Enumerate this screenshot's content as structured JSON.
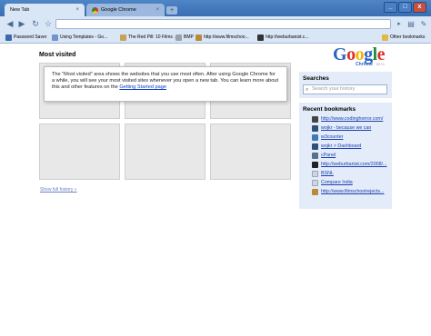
{
  "tabs": [
    {
      "label": "New Tab",
      "active": true
    },
    {
      "label": "Google Chrome",
      "active": false
    }
  ],
  "new_tab_button": "+",
  "window_controls": {
    "minimize": "_",
    "maximize": "□",
    "close": "x"
  },
  "omnibox": {
    "value": ""
  },
  "bookmarks_bar": {
    "items": [
      {
        "label": "Password Saver",
        "icon": "bookmark-icon",
        "color": "#3b6aa8"
      },
      {
        "label": "Using Templates - Go...",
        "icon": "page-icon",
        "color": "#6f95c9"
      },
      {
        "label": "The Red Pill: 10 Films ...",
        "icon": "page-icon",
        "color": "#c4a45a"
      },
      {
        "label": "BMP",
        "icon": "page-icon",
        "color": "#9aa1a8"
      },
      {
        "label": "http://www.filmschoo...",
        "icon": "page-icon",
        "color": "#b88a3a"
      },
      {
        "label": "http://weburbanist.c...",
        "icon": "page-icon",
        "color": "#333333"
      }
    ],
    "other_bookmarks": "Other bookmarks"
  },
  "main": {
    "most_visited_title": "Most visited",
    "info_text_1": "The \"Most visited\" area shows the websites that you use most often. After using Google Chrome for a while, you will see your most visited sites whenever you open a new tab. You can learn more about this and other features on the ",
    "info_link": "Getting Started page",
    "show_full_history": "Show full history »"
  },
  "logo": {
    "brand": "Google",
    "product": "Chrome",
    "badge": "BETA"
  },
  "sidebar": {
    "searches_title": "Searches",
    "search_placeholder": "Search your history",
    "recent_bookmarks_title": "Recent bookmarks",
    "recent_bookmarks": [
      {
        "label": "http://www.codinghorror.com/",
        "icon": "bookmark-icon",
        "color": "#444444"
      },
      {
        "label": "wojkr - because we can",
        "icon": "bookmark-icon",
        "color": "#2d4f7a"
      },
      {
        "label": "w3counter",
        "icon": "bookmark-icon",
        "color": "#3d7ab8"
      },
      {
        "label": "wojkr > Dashboard",
        "icon": "bookmark-icon",
        "color": "#2d4f7a"
      },
      {
        "label": "cPanel",
        "icon": "bookmark-icon",
        "color": "#5b6f8f"
      },
      {
        "label": "http://weburbanist.com/2008/...",
        "icon": "bookmark-icon",
        "color": "#222222"
      },
      {
        "label": "BSNL",
        "icon": "page-icon",
        "color": "#cfd6df"
      },
      {
        "label": "Compare India",
        "icon": "page-icon",
        "color": "#cfd6df"
      },
      {
        "label": "http://www.filmschoolrejects...",
        "icon": "bookmark-icon",
        "color": "#b88a3a"
      }
    ]
  }
}
